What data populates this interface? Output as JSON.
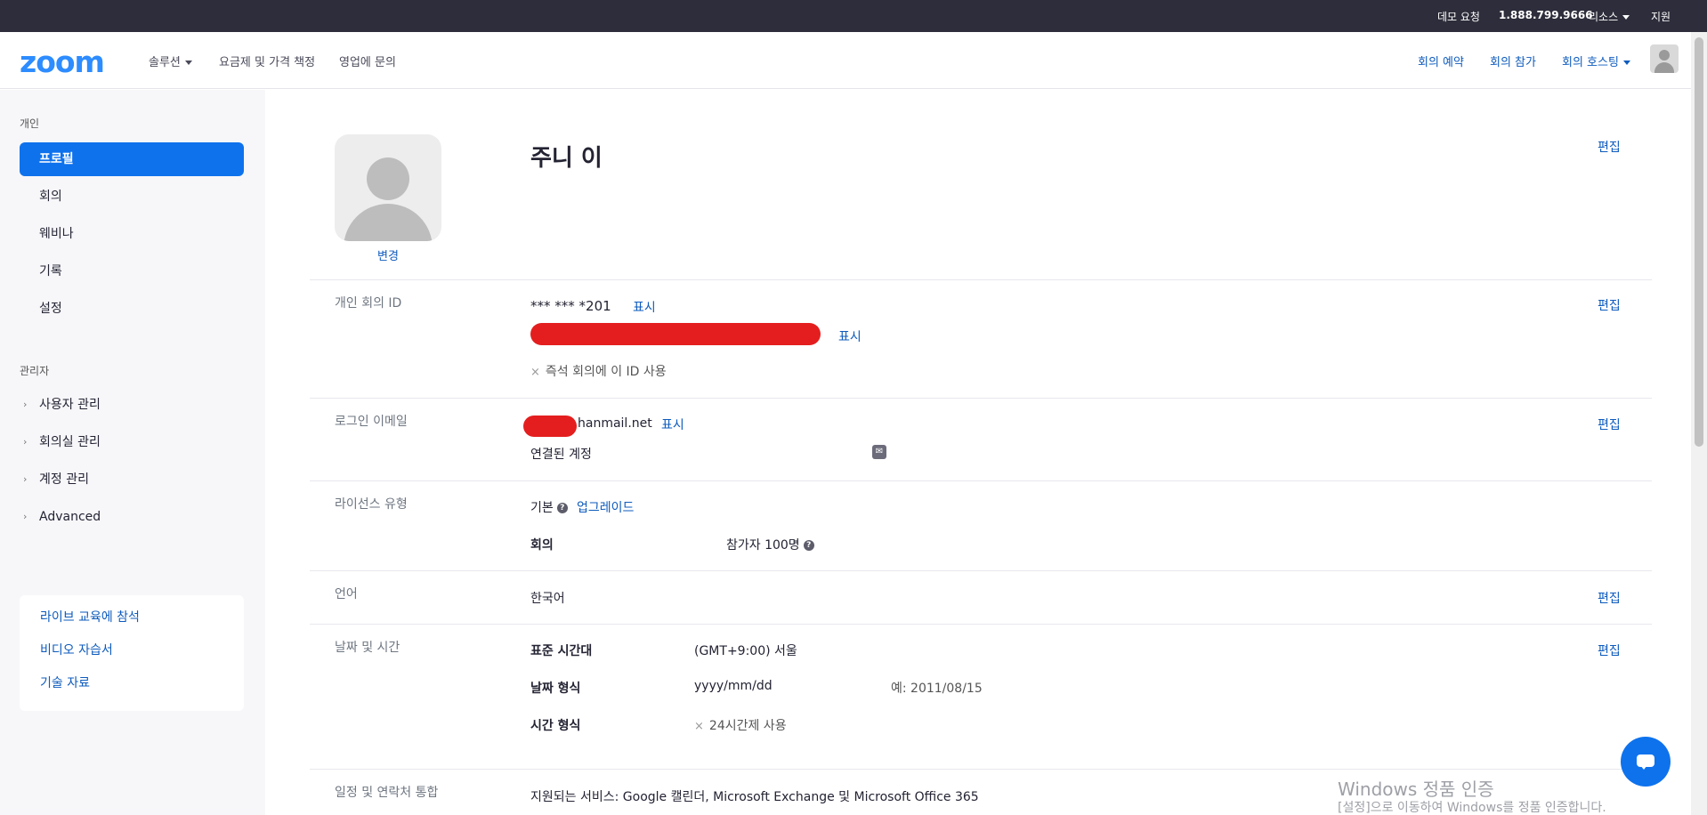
{
  "topbar": {
    "demo": "데모 요청",
    "phone": "1.888.799.9666",
    "resources": "리소스",
    "support": "지원"
  },
  "header": {
    "logo": "zoom",
    "nav": [
      "솔루션",
      "요금제 및 가격 책정",
      "영업에 문의"
    ],
    "right_nav": [
      "회의 예약",
      "회의 참가",
      "회의 호스팅"
    ]
  },
  "sidebar": {
    "personal_label": "개인",
    "personal_items": [
      "프로필",
      "회의",
      "웨비나",
      "기록",
      "설정"
    ],
    "admin_label": "관리자",
    "admin_items": [
      "사용자 관리",
      "회의실 관리",
      "계정 관리",
      "Advanced"
    ],
    "help_links": [
      "라이브 교육에 참석",
      "비디오 자습서",
      "기술 자료"
    ]
  },
  "profile": {
    "name": "주니 이",
    "change_photo": "변경",
    "edit": "편집",
    "show": "표시",
    "pmi_label": "개인 회의 ID",
    "pmi_value": "*** *** *201",
    "pmi_instant": "즉석 회의에 이 ID 사용",
    "email_label": "로그인 이메일",
    "email_value": "hanmail.net",
    "linked_account": "연결된 계정",
    "license_label": "라이선스 유형",
    "license_basic": "기본",
    "upgrade": "업그레이드",
    "meeting_label": "회의",
    "participants": "참가자 100명",
    "language_label": "언어",
    "language_value": "한국어",
    "datetime_label": "날짜 및 시간",
    "timezone_label": "표준 시간대",
    "timezone_value": "(GMT+9:00) 서울",
    "date_format_label": "날짜 형식",
    "date_format_value": "yyyy/mm/dd",
    "date_example": "예: 2011/08/15",
    "time_format_label": "시간 형식",
    "time_format_value": "24시간제 사용",
    "calendar_label": "일정 및 연락처 통합",
    "calendar_value": "지원되는 서비스: Google 캘린더, Microsoft Exchange 및 Microsoft Office 365"
  },
  "watermark": {
    "line1": "Windows 정품 인증",
    "line2": "[설정]으로 이동하여 Windows를 정품 인증합니다."
  },
  "colors": {
    "brand": "#2d8cff",
    "active_nav": "#0e72ed",
    "link": "#0e5bbd",
    "topbar": "#2d2d3b"
  }
}
